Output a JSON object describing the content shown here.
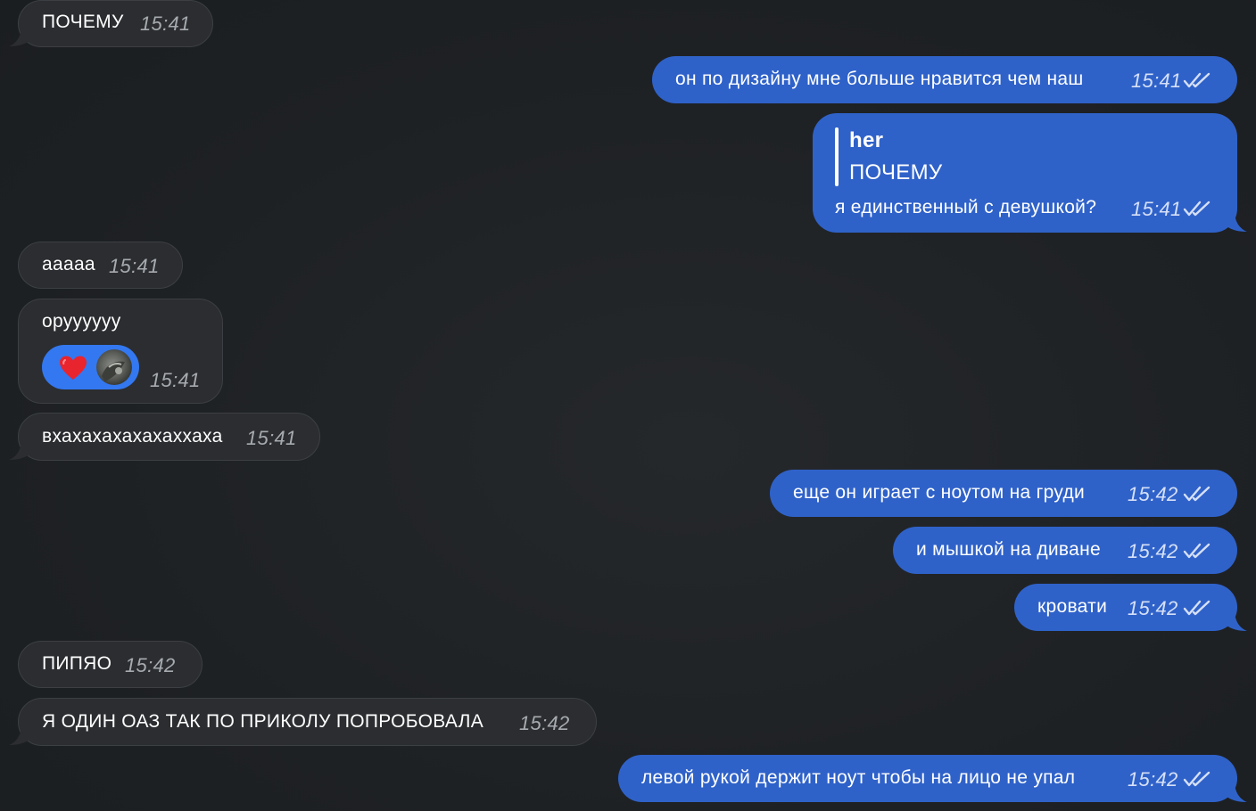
{
  "conversation": {
    "messages": [
      {
        "id": "m1",
        "direction": "incoming",
        "text": "ПОЧЕМУ",
        "time": "15:41"
      },
      {
        "id": "m2",
        "direction": "outgoing",
        "text": "он по дизайну мне больше нравится чем наш",
        "time": "15:41",
        "status": "read"
      },
      {
        "id": "m3",
        "direction": "outgoing",
        "reply_to": {
          "author": "her",
          "text": "ПОЧЕМУ"
        },
        "text": "я единственный с девушкой?",
        "time": "15:41",
        "status": "read"
      },
      {
        "id": "m4",
        "direction": "incoming",
        "text": "ааааа",
        "time": "15:41"
      },
      {
        "id": "m5",
        "direction": "incoming",
        "text": "оруууууу",
        "time": "15:41",
        "reaction": {
          "emoji": "❤️",
          "icon": "heart-icon"
        }
      },
      {
        "id": "m6",
        "direction": "incoming",
        "text": "вхахахахахахаххаха",
        "time": "15:41"
      },
      {
        "id": "m7",
        "direction": "outgoing",
        "text": "еще он играет с ноутом на груди",
        "time": "15:42",
        "status": "read"
      },
      {
        "id": "m8",
        "direction": "outgoing",
        "text": "и мышкой на диване",
        "time": "15:42",
        "status": "read"
      },
      {
        "id": "m9",
        "direction": "outgoing",
        "text": "кровати",
        "time": "15:42",
        "status": "read"
      },
      {
        "id": "m10",
        "direction": "incoming",
        "text": "ПИПЯО",
        "time": "15:42"
      },
      {
        "id": "m11",
        "direction": "incoming",
        "text": "Я ОДИН ОАЗ ТАК ПО ПРИКОЛУ ПОПРОБОВАЛА",
        "time": "15:42"
      },
      {
        "id": "m12",
        "direction": "outgoing",
        "text": "левой рукой держит ноут чтобы на лицо не упал",
        "time": "15:42",
        "status": "read"
      }
    ]
  },
  "colors": {
    "background": "#1f2225",
    "incoming_bubble": "#2b2d30",
    "outgoing_bubble": "#2f62c9",
    "reaction_pill": "#3378f0",
    "heart": "#e8242e"
  },
  "icons": {
    "read_status": "double-check-icon",
    "reaction": "heart-icon",
    "reactor": "avatar"
  }
}
